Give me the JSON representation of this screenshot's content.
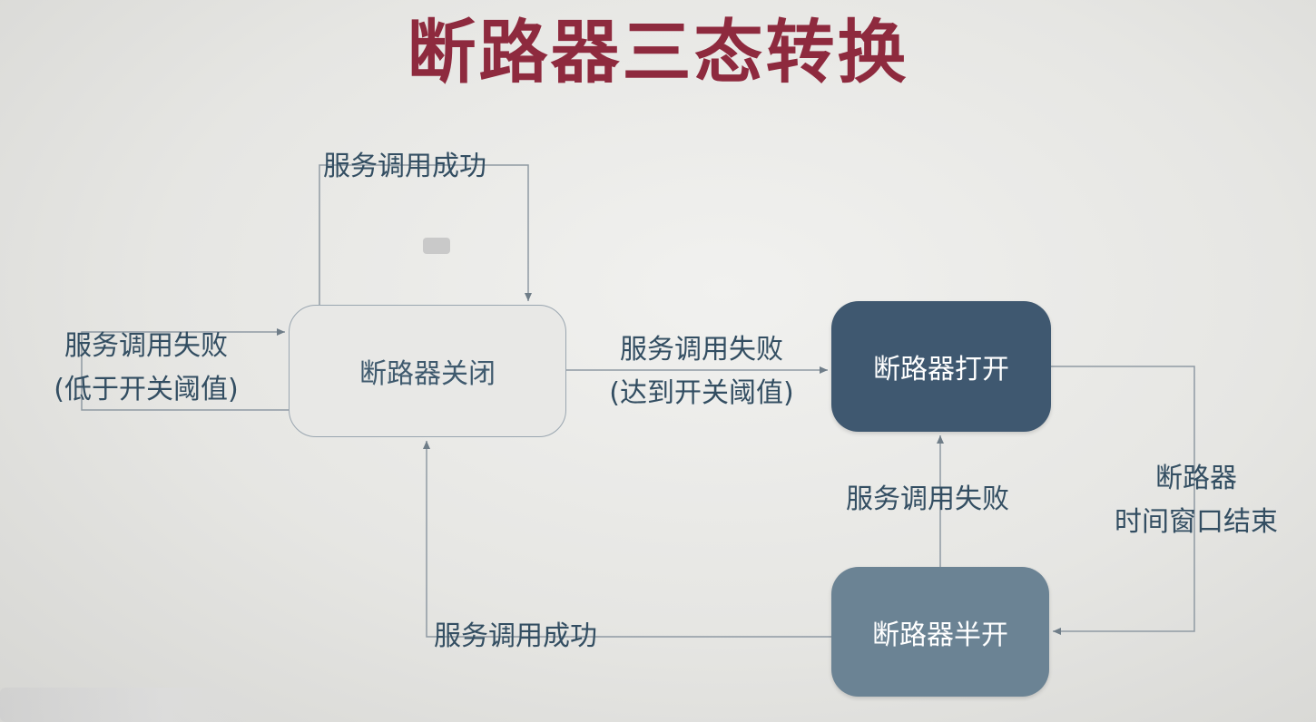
{
  "title": "断路器三态转换",
  "nodes": {
    "closed": "断路器关闭",
    "open": "断路器打开",
    "half_open": "断路器半开"
  },
  "transitions": {
    "closed_self_success": "服务调用成功",
    "closed_self_fail": [
      "服务调用失败",
      "(低于开关阈值)"
    ],
    "closed_to_open": [
      "服务调用失败",
      "(达到开关阈值)"
    ],
    "half_to_open": "服务调用失败",
    "open_to_half": [
      "断路器",
      "时间窗口结束"
    ],
    "half_to_closed": "服务调用成功"
  },
  "colors": {
    "title": "#8e2a3e",
    "line": "#8f9aa3",
    "label": "#334e62",
    "closed_fill": "#e8e8e6",
    "open_fill": "#3f5870",
    "half_fill": "#6b8394"
  }
}
